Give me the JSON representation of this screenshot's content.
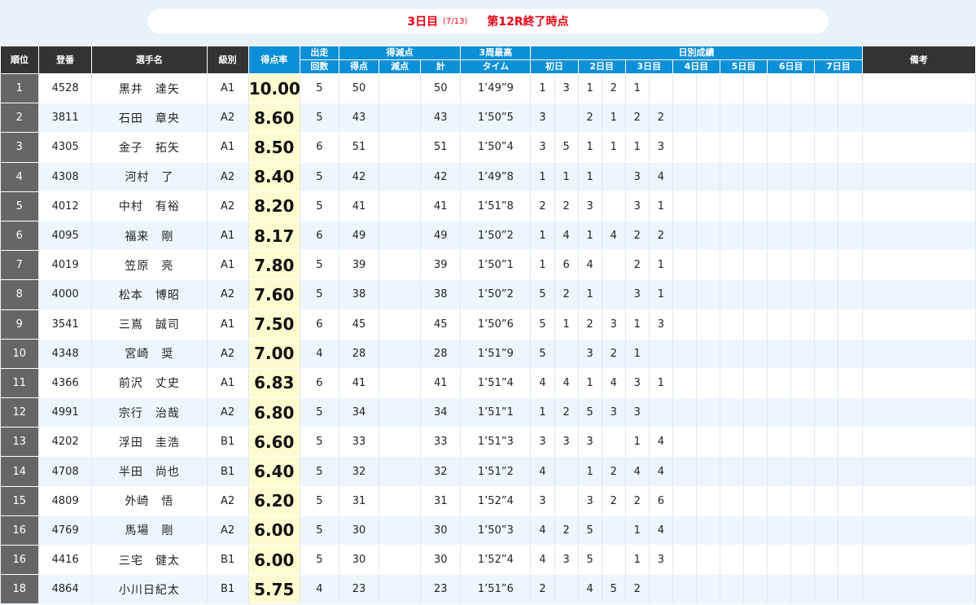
{
  "banner": {
    "day_label": "3日目",
    "date": "(7/13)",
    "status": "第12R終了時点"
  },
  "headers": {
    "rank": "順位",
    "reg": "登番",
    "name": "選手名",
    "class": "級別",
    "rate": "得点率",
    "starts_top": "出走",
    "starts_bottom": "回数",
    "points_group": "得減点",
    "points": "得点",
    "deduct": "減点",
    "total": "計",
    "lap_top": "3周最高",
    "lap_bottom": "タイム",
    "daily_group": "日別成績",
    "note": "備考",
    "days": [
      "初日",
      "2日目",
      "3日目",
      "4日目",
      "5日目",
      "6日目",
      "7日目"
    ]
  },
  "rows": [
    {
      "rank": "1",
      "reg": "4528",
      "name": "黒井　達矢",
      "class": "A1",
      "rate": "10.00",
      "starts": "5",
      "points": "50",
      "deduct": "",
      "total": "50",
      "lap": "1’49”9",
      "daily": [
        "1",
        "3",
        "1",
        "2",
        "1",
        "",
        "",
        "",
        "",
        "",
        "",
        "",
        "",
        ""
      ]
    },
    {
      "rank": "2",
      "reg": "3811",
      "name": "石田　章央",
      "class": "A2",
      "rate": "8.60",
      "starts": "5",
      "points": "43",
      "deduct": "",
      "total": "43",
      "lap": "1’50”5",
      "daily": [
        "3",
        "",
        "2",
        "1",
        "2",
        "2",
        "",
        "",
        "",
        "",
        "",
        "",
        "",
        ""
      ]
    },
    {
      "rank": "3",
      "reg": "4305",
      "name": "金子　拓矢",
      "class": "A1",
      "rate": "8.50",
      "starts": "6",
      "points": "51",
      "deduct": "",
      "total": "51",
      "lap": "1’50”4",
      "daily": [
        "3",
        "5",
        "1",
        "1",
        "1",
        "3",
        "",
        "",
        "",
        "",
        "",
        "",
        "",
        ""
      ]
    },
    {
      "rank": "4",
      "reg": "4308",
      "name": "河村　了",
      "class": "A2",
      "rate": "8.40",
      "starts": "5",
      "points": "42",
      "deduct": "",
      "total": "42",
      "lap": "1’49”8",
      "daily": [
        "1",
        "1",
        "1",
        "",
        "3",
        "4",
        "",
        "",
        "",
        "",
        "",
        "",
        "",
        ""
      ]
    },
    {
      "rank": "5",
      "reg": "4012",
      "name": "中村　有裕",
      "class": "A2",
      "rate": "8.20",
      "starts": "5",
      "points": "41",
      "deduct": "",
      "total": "41",
      "lap": "1’51”8",
      "daily": [
        "2",
        "2",
        "3",
        "",
        "3",
        "1",
        "",
        "",
        "",
        "",
        "",
        "",
        "",
        ""
      ]
    },
    {
      "rank": "6",
      "reg": "4095",
      "name": "福来　剛",
      "class": "A1",
      "rate": "8.17",
      "starts": "6",
      "points": "49",
      "deduct": "",
      "total": "49",
      "lap": "1’50”2",
      "daily": [
        "1",
        "4",
        "1",
        "4",
        "2",
        "2",
        "",
        "",
        "",
        "",
        "",
        "",
        "",
        ""
      ]
    },
    {
      "rank": "7",
      "reg": "4019",
      "name": "笠原　亮",
      "class": "A1",
      "rate": "7.80",
      "starts": "5",
      "points": "39",
      "deduct": "",
      "total": "39",
      "lap": "1’50”1",
      "daily": [
        "1",
        "6",
        "4",
        "",
        "2",
        "1",
        "",
        "",
        "",
        "",
        "",
        "",
        "",
        ""
      ]
    },
    {
      "rank": "8",
      "reg": "4000",
      "name": "松本　博昭",
      "class": "A2",
      "rate": "7.60",
      "starts": "5",
      "points": "38",
      "deduct": "",
      "total": "38",
      "lap": "1’50”2",
      "daily": [
        "5",
        "2",
        "1",
        "",
        "3",
        "1",
        "",
        "",
        "",
        "",
        "",
        "",
        "",
        ""
      ]
    },
    {
      "rank": "9",
      "reg": "3541",
      "name": "三嶌　誠司",
      "class": "A1",
      "rate": "7.50",
      "starts": "6",
      "points": "45",
      "deduct": "",
      "total": "45",
      "lap": "1’50”6",
      "daily": [
        "5",
        "1",
        "2",
        "3",
        "1",
        "3",
        "",
        "",
        "",
        "",
        "",
        "",
        "",
        ""
      ]
    },
    {
      "rank": "10",
      "reg": "4348",
      "name": "宮崎　奨",
      "class": "A2",
      "rate": "7.00",
      "starts": "4",
      "points": "28",
      "deduct": "",
      "total": "28",
      "lap": "1’51”9",
      "daily": [
        "5",
        "",
        "3",
        "2",
        "1",
        "",
        "",
        "",
        "",
        "",
        "",
        "",
        "",
        ""
      ]
    },
    {
      "rank": "11",
      "reg": "4366",
      "name": "前沢　丈史",
      "class": "A1",
      "rate": "6.83",
      "starts": "6",
      "points": "41",
      "deduct": "",
      "total": "41",
      "lap": "1’51”4",
      "daily": [
        "4",
        "4",
        "1",
        "4",
        "3",
        "1",
        "",
        "",
        "",
        "",
        "",
        "",
        "",
        ""
      ]
    },
    {
      "rank": "12",
      "reg": "4991",
      "name": "宗行　治哉",
      "class": "A2",
      "rate": "6.80",
      "starts": "5",
      "points": "34",
      "deduct": "",
      "total": "34",
      "lap": "1’51”1",
      "daily": [
        "1",
        "2",
        "5",
        "3",
        "3",
        "",
        "",
        "",
        "",
        "",
        "",
        "",
        "",
        ""
      ]
    },
    {
      "rank": "13",
      "reg": "4202",
      "name": "浮田　圭浩",
      "class": "B1",
      "rate": "6.60",
      "starts": "5",
      "points": "33",
      "deduct": "",
      "total": "33",
      "lap": "1’51”3",
      "daily": [
        "3",
        "3",
        "3",
        "",
        "1",
        "4",
        "",
        "",
        "",
        "",
        "",
        "",
        "",
        ""
      ]
    },
    {
      "rank": "14",
      "reg": "4708",
      "name": "半田　尚也",
      "class": "B1",
      "rate": "6.40",
      "starts": "5",
      "points": "32",
      "deduct": "",
      "total": "32",
      "lap": "1’51”2",
      "daily": [
        "4",
        "",
        "1",
        "2",
        "4",
        "4",
        "",
        "",
        "",
        "",
        "",
        "",
        "",
        ""
      ]
    },
    {
      "rank": "15",
      "reg": "4809",
      "name": "外崎　悟",
      "class": "A2",
      "rate": "6.20",
      "starts": "5",
      "points": "31",
      "deduct": "",
      "total": "31",
      "lap": "1’52”4",
      "daily": [
        "3",
        "",
        "3",
        "2",
        "2",
        "6",
        "",
        "",
        "",
        "",
        "",
        "",
        "",
        ""
      ]
    },
    {
      "rank": "16",
      "reg": "4769",
      "name": "馬場　剛",
      "class": "A2",
      "rate": "6.00",
      "starts": "5",
      "points": "30",
      "deduct": "",
      "total": "30",
      "lap": "1’50”3",
      "daily": [
        "4",
        "2",
        "5",
        "",
        "1",
        "4",
        "",
        "",
        "",
        "",
        "",
        "",
        "",
        ""
      ]
    },
    {
      "rank": "16",
      "reg": "4416",
      "name": "三宅　健太",
      "class": "B1",
      "rate": "6.00",
      "starts": "5",
      "points": "30",
      "deduct": "",
      "total": "30",
      "lap": "1’52”4",
      "daily": [
        "4",
        "3",
        "5",
        "",
        "1",
        "3",
        "",
        "",
        "",
        "",
        "",
        "",
        "",
        ""
      ]
    },
    {
      "rank": "18",
      "reg": "4864",
      "name": "小川日紀太",
      "class": "B1",
      "rate": "5.75",
      "starts": "4",
      "points": "23",
      "deduct": "",
      "total": "23",
      "lap": "1’51”6",
      "daily": [
        "2",
        "",
        "4",
        "5",
        "2",
        "",
        "",
        "",
        "",
        "",
        "",
        "",
        "",
        ""
      ]
    }
  ],
  "colors": {
    "header_dark": "#333333",
    "header_blue": "#0a8fd9",
    "rank_cell": "#666666",
    "rate_highlight": "#fffbd0",
    "banner_text": "#e60012"
  }
}
